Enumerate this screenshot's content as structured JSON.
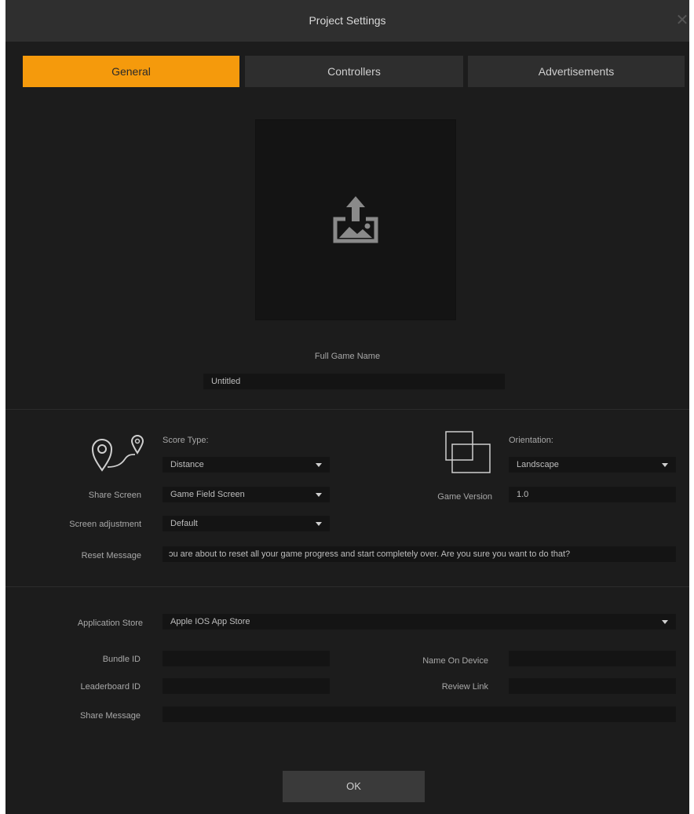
{
  "window": {
    "title": "Project Settings",
    "close_glyph": "✕"
  },
  "tabs": [
    {
      "label": "General",
      "active": true
    },
    {
      "label": "Controllers",
      "active": false
    },
    {
      "label": "Advertisements",
      "active": false
    }
  ],
  "game": {
    "image_icon": "image-upload-icon",
    "full_name_label": "Full Game Name",
    "full_name_value": "Untitled"
  },
  "score": {
    "icon": "location-route-icon",
    "type_label": "Score Type:",
    "type_value": "Distance"
  },
  "orientation": {
    "icon": "orientation-icon",
    "label": "Orientation:",
    "value": "Landscape"
  },
  "share_screen": {
    "label": "Share Screen",
    "value": "Game Field Screen"
  },
  "game_version": {
    "label": "Game Version",
    "value": "1.0"
  },
  "screen_adjustment": {
    "label": "Screen adjustment",
    "value": "Default"
  },
  "reset_message": {
    "label": "Reset Message",
    "value": "ɔu are about to reset all your game progress and start completely over.  Are you sure you want to do that?"
  },
  "store": {
    "app_store_label": "Application Store",
    "app_store_value": "Apple IOS App Store",
    "bundle_id_label": "Bundle ID",
    "bundle_id_value": "",
    "name_on_device_label": "Name On Device",
    "name_on_device_value": "",
    "leaderboard_id_label": "Leaderboard ID",
    "leaderboard_id_value": "",
    "review_link_label": "Review Link",
    "review_link_value": "",
    "share_message_label": "Share Message",
    "share_message_value": ""
  },
  "ok_label": "OK",
  "colors": {
    "accent": "#f59a0c",
    "background": "#1c1c1c",
    "field": "#141414"
  }
}
